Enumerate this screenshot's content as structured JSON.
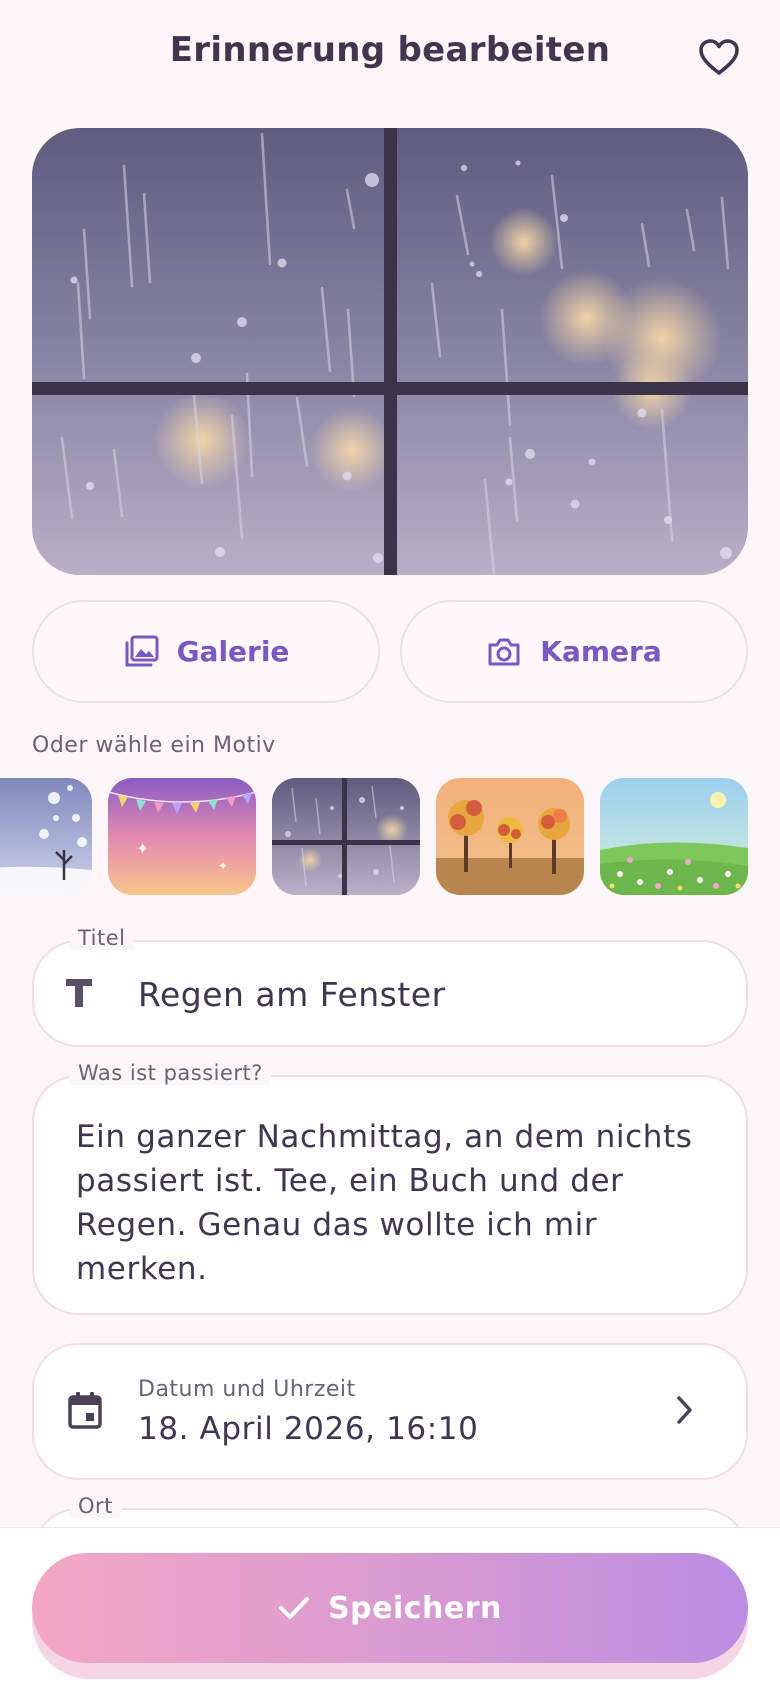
{
  "header": {
    "title": "Erinnerung bearbeiten",
    "favorite_icon": "heart-outline-icon"
  },
  "media": {
    "gallery_label": "Galerie",
    "camera_label": "Kamera"
  },
  "motif": {
    "label": "Oder wähle ein Motiv",
    "options": [
      "winter-snow",
      "party-garland",
      "rain-window",
      "autumn-trees",
      "spring-meadow"
    ],
    "selected": "rain-window"
  },
  "form": {
    "title_legend": "Titel",
    "title_value": "Regen am Fenster",
    "description_legend": "Was ist passiert?",
    "description_value": "Ein ganzer Nachmittag, an dem nichts passiert ist. Tee, ein Buch und der Regen. Genau das wollte ich mir merken.",
    "datetime_label": "Datum und Uhrzeit",
    "datetime_value": "18. April 2026, 16:10",
    "location_legend": "Ort"
  },
  "actions": {
    "save_label": "Speichern"
  },
  "colors": {
    "accent": "#7b57c2",
    "selected_border": "#ee86ae",
    "save_gradient_start": "#f3a7c3",
    "save_gradient_end": "#bb8de3"
  }
}
